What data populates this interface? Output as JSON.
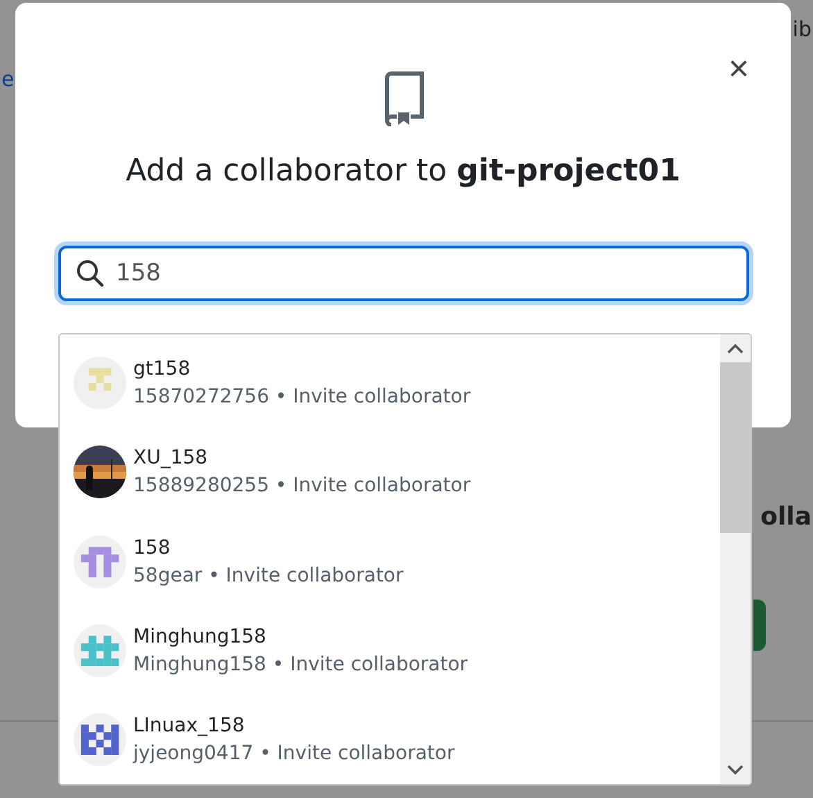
{
  "background_page": {
    "link_fragment": "e",
    "right_fragment_top": "ib",
    "right_heading_fragment": "olla"
  },
  "dialog": {
    "title": "Add a collaborator to ",
    "repo": "git-project01",
    "close": "×",
    "search": {
      "value": "158"
    },
    "results": [
      {
        "name": "gt158",
        "detail": "15870272756 • Invite collaborator",
        "avatar": {
          "kind": "identicon",
          "color": "#e6dfa0"
        }
      },
      {
        "name": "XU_158",
        "detail": "15889280255 • Invite collaborator"
      },
      {
        "name": "158",
        "detail": "58gear • Invite collaborator",
        "avatar": {
          "kind": "identicon",
          "color": "#a58ee0"
        }
      },
      {
        "name": "Minghung158",
        "detail": "Minghung158 • Invite collaborator",
        "avatar": {
          "kind": "identicon",
          "color": "#4cc0c8"
        }
      },
      {
        "name": "LInuax_158",
        "detail": "jyjeong0417 • Invite collaborator",
        "avatar": {
          "kind": "identicon",
          "color": "#5263cc"
        }
      }
    ]
  }
}
